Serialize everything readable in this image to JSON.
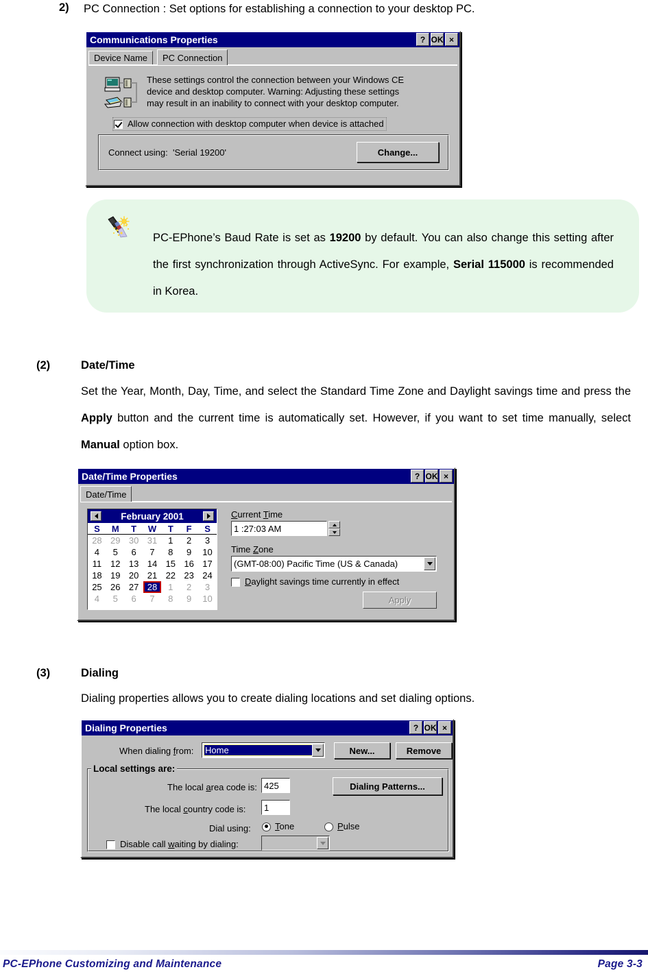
{
  "page": {
    "intro_item": {
      "marker": "2)",
      "text": "PC Connection : Set options for establishing a connection to your desktop PC."
    }
  },
  "comm_dialog": {
    "title": "Communications Properties",
    "titlebar_buttons": [
      "?",
      "OK",
      "×"
    ],
    "tabs": [
      {
        "label": "Device Name",
        "active": false
      },
      {
        "label": "PC Connection",
        "active": true
      }
    ],
    "icon": "pc-connection-icon",
    "description_lines": [
      "These settings control the connection between your Windows CE",
      "device and desktop computer.  Warning: Adjusting these settings",
      "may result in an inability to connect with your desktop computer."
    ],
    "allow_checkbox": {
      "label": "Allow connection with desktop computer when device is attached",
      "checked": true
    },
    "connect_using_label": "Connect using:",
    "connect_using_value": "'Serial 19200'",
    "change_button": "Change..."
  },
  "note": {
    "icon": "magic-wand-icon",
    "bg_color": "#e6f7e8",
    "parts": [
      {
        "text": "PC-EPhone’s Baud Rate is set as ",
        "bold": false
      },
      {
        "text": "19200",
        "bold": true
      },
      {
        "text": " by default. You can also change this setting after the first synchronization through ActiveSync. For example, ",
        "bold": false
      },
      {
        "text": "Serial 115000",
        "bold": true
      },
      {
        "text": " is recommended in Korea.",
        "bold": false
      }
    ]
  },
  "section2": {
    "marker": "(2)",
    "heading": "Date/Time",
    "body_parts": [
      {
        "text": "Set the Year, Month, Day, Time, and select the Standard Time Zone and Daylight savings time and press the ",
        "bold": false
      },
      {
        "text": "Apply",
        "bold": true
      },
      {
        "text": " button and the current time is automatically set. However, if you want to set time manually, select ",
        "bold": false
      },
      {
        "text": "Manual",
        "bold": true
      },
      {
        "text": " option box.",
        "bold": false
      }
    ]
  },
  "datetime_dialog": {
    "title": "Date/Time Properties",
    "titlebar_buttons": [
      "?",
      "OK",
      "×"
    ],
    "tabs": [
      {
        "label": "Date/Time",
        "active": true
      }
    ],
    "calendar": {
      "month_label": "February 2001",
      "prev_label": "previous-month",
      "next_label": "next-month",
      "weekday_headers": [
        "S",
        "M",
        "T",
        "W",
        "T",
        "F",
        "S"
      ],
      "weeks": [
        [
          {
            "d": "28",
            "o": true
          },
          {
            "d": "29",
            "o": true
          },
          {
            "d": "30",
            "o": true
          },
          {
            "d": "31",
            "o": true
          },
          {
            "d": "1"
          },
          {
            "d": "2"
          },
          {
            "d": "3"
          }
        ],
        [
          {
            "d": "4"
          },
          {
            "d": "5"
          },
          {
            "d": "6"
          },
          {
            "d": "7"
          },
          {
            "d": "8"
          },
          {
            "d": "9"
          },
          {
            "d": "10"
          }
        ],
        [
          {
            "d": "11"
          },
          {
            "d": "12"
          },
          {
            "d": "13"
          },
          {
            "d": "14"
          },
          {
            "d": "15"
          },
          {
            "d": "16"
          },
          {
            "d": "17"
          }
        ],
        [
          {
            "d": "18"
          },
          {
            "d": "19"
          },
          {
            "d": "20"
          },
          {
            "d": "21"
          },
          {
            "d": "22"
          },
          {
            "d": "23"
          },
          {
            "d": "24"
          }
        ],
        [
          {
            "d": "25"
          },
          {
            "d": "26"
          },
          {
            "d": "27"
          },
          {
            "d": "28",
            "sel": true
          },
          {
            "d": "1",
            "o": true
          },
          {
            "d": "2",
            "o": true
          },
          {
            "d": "3",
            "o": true
          }
        ],
        [
          {
            "d": "4",
            "o": true
          },
          {
            "d": "5",
            "o": true
          },
          {
            "d": "6",
            "o": true
          },
          {
            "d": "7",
            "o": true
          },
          {
            "d": "8",
            "o": true
          },
          {
            "d": "9",
            "o": true
          },
          {
            "d": "10",
            "o": true
          }
        ]
      ]
    },
    "current_time_label": "Current Time",
    "current_time_value": "1 :27:03 AM",
    "time_zone_label": "Time Zone",
    "time_zone_value": "(GMT-08:00) Pacific Time (US & Canada)",
    "daylight_checkbox": {
      "label": "Daylight savings time currently in effect",
      "checked": false
    },
    "apply_button": "Apply",
    "apply_disabled": true
  },
  "section3": {
    "marker": "(3)",
    "heading": "Dialing",
    "body": "Dialing properties allows you to create dialing locations and set dialing options."
  },
  "dialing_dialog": {
    "title": "Dialing Properties",
    "titlebar_buttons": [
      "?",
      "OK",
      "×"
    ],
    "when_dialing_label": "When dialing from:",
    "when_dialing_value": "Home",
    "new_button": "New...",
    "remove_button": "Remove",
    "group_label": "Local settings are:",
    "area_code_label": "The local area code is:",
    "area_code_value": "425",
    "dialing_patterns_button": "Dialing Patterns...",
    "country_code_label": "The local country code is:",
    "country_code_value": "1",
    "dial_using_label": "Dial using:",
    "tone_label": "Tone",
    "tone_selected": true,
    "pulse_label": "Pulse",
    "pulse_selected": false,
    "disable_call_waiting": {
      "label": "Disable call waiting by dialing:",
      "checked": false,
      "value": ""
    }
  },
  "footer": {
    "left": "PC-EPhone Customizing and Maintenance",
    "right": "Page 3-3",
    "accent_color": "#1a1a8c"
  }
}
